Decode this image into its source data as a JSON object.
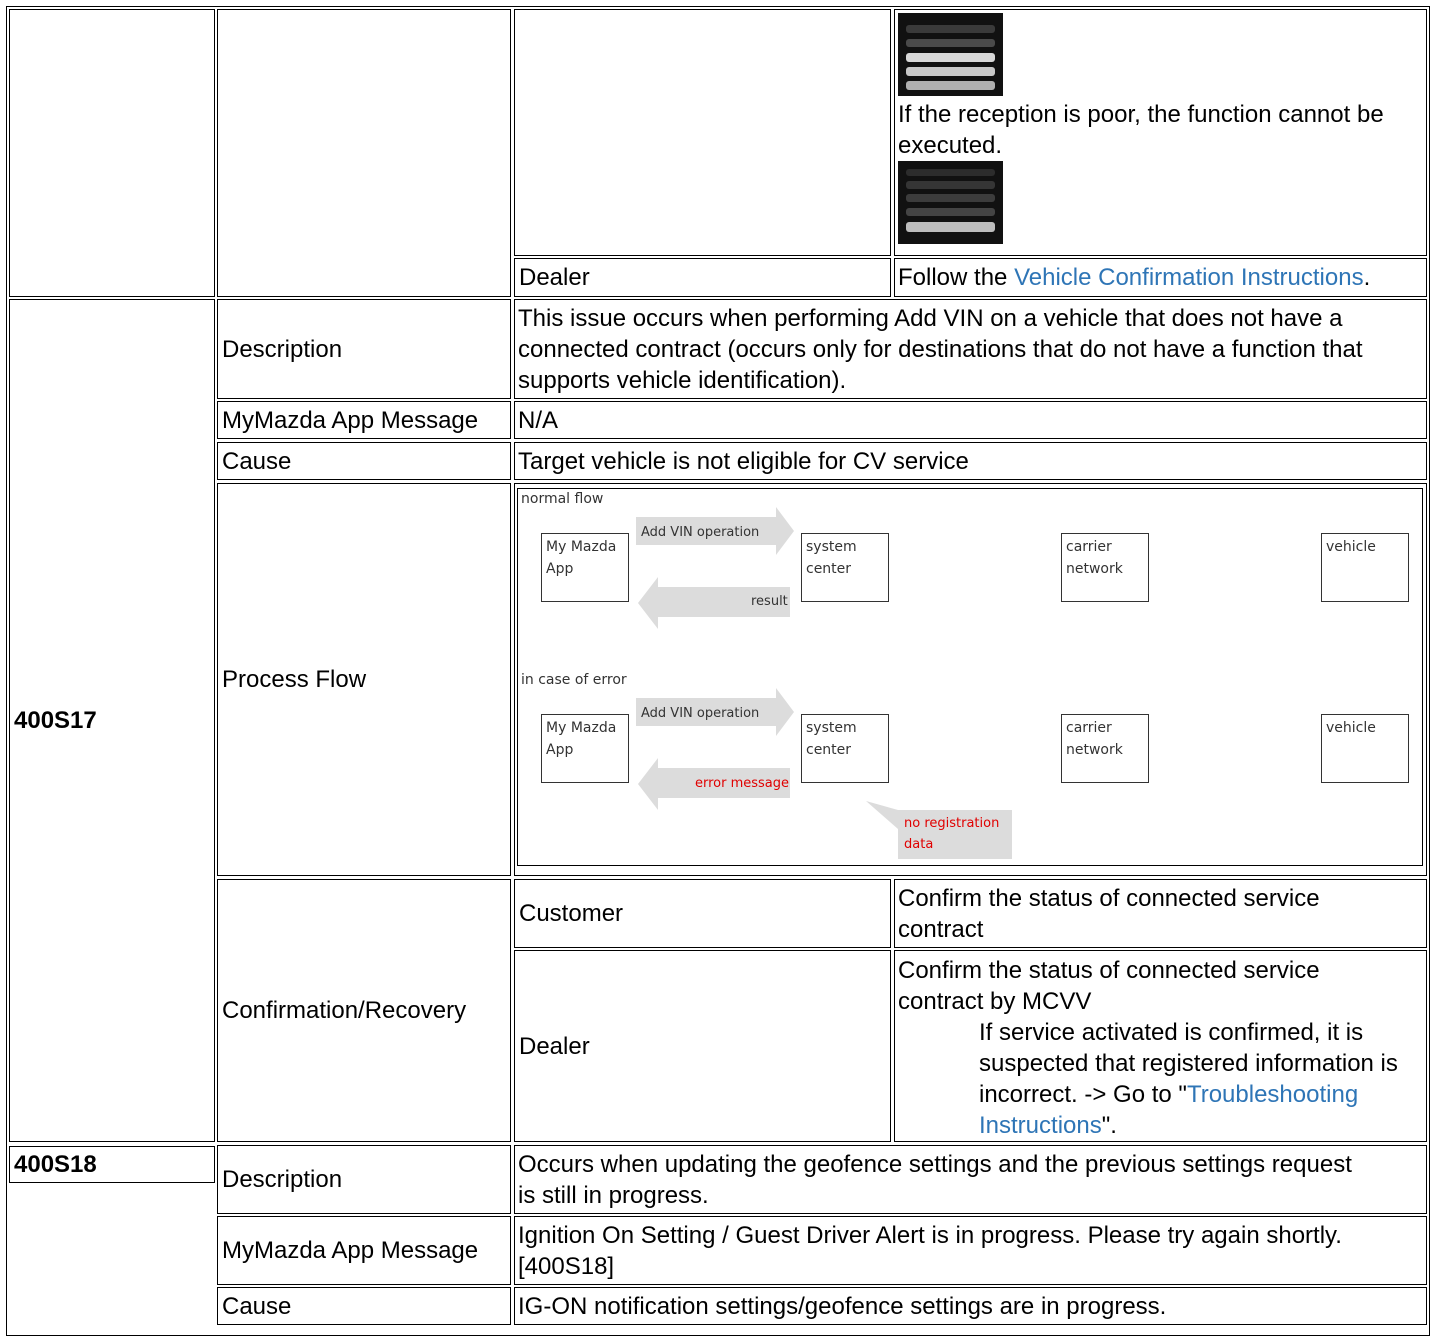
{
  "top": {
    "reception_note": "If the reception is poor, the function cannot be executed.",
    "dealer_label": "Dealer",
    "follow_prefix": "Follow the ",
    "follow_link": "Vehicle Confirmation Instructions",
    "follow_suffix": "."
  },
  "r17": {
    "code": "400S17",
    "description_label": "Description",
    "description": "This issue occurs when performing Add VIN on a vehicle that does not have a connected contract (occurs only for destinations that do not have a function that supports vehicle identification).",
    "message_label": "MyMazda App Message",
    "message": "N/A",
    "cause_label": "Cause",
    "cause": "Target vehicle is not eligible for CV service",
    "process_label": "Process Flow",
    "confirm_label": "Confirmation/Recovery",
    "customer_label": "Customer",
    "customer_action": "Confirm the status of connected service contract",
    "dealer_label": "Dealer",
    "dealer_action": "Confirm the status of connected service contract by MCVV",
    "dealer_detail": "If service activated is confirmed, it is suspected that registered information is incorrect. -> Go to \"",
    "dealer_link": "Troubleshooting Instructions",
    "dealer_suffix": "\"."
  },
  "diagram": {
    "normal_title": "normal flow",
    "error_title": "in case of error",
    "add_vin": "Add VIN operation",
    "result": "result",
    "error_message": "error message",
    "no_registration": "no registration data",
    "app_line1": "My Mazda",
    "app_line2": "App",
    "center_line1": "system",
    "center_line2": "center",
    "carrier_line1": "carrier",
    "carrier_line2": "network",
    "vehicle": "vehicle"
  },
  "r18": {
    "code": "400S18",
    "description_label": "Description",
    "description": "Occurs when updating the geofence settings and the previous settings request is still in progress.",
    "message_label": "MyMazda App Message",
    "message": "Ignition On Setting / Guest Driver Alert is in progress. Please try again shortly. [400S18]",
    "cause_label": "Cause",
    "cause": "IG-ON notification settings/geofence settings are in progress."
  },
  "colors": {
    "link": "#2e75b6",
    "error": "#e00000"
  }
}
